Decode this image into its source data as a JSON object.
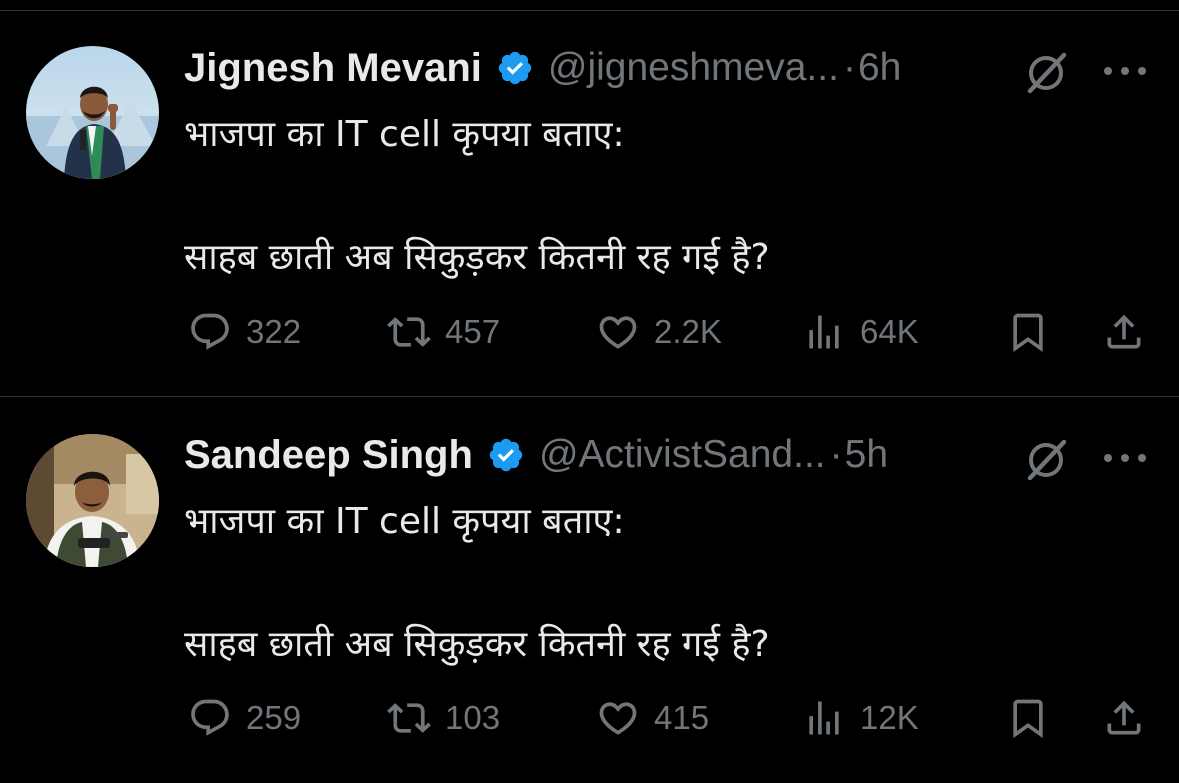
{
  "tweets": [
    {
      "name": "Jignesh Mevani",
      "handle": "@jigneshmeva...",
      "separator": "·",
      "time": "6h",
      "text_line1": "भाजपा का IT cell कृपया बताए:",
      "text_line2": "साहब छाती अब सिकुड़कर कितनी रह गई है?",
      "replies": "322",
      "retweets": "457",
      "likes": "2.2K",
      "views": "64K"
    },
    {
      "name": "Sandeep Singh",
      "handle": "@ActivistSand...",
      "separator": "·",
      "time": "5h",
      "text_line1": "भाजपा का IT cell कृपया बताए:",
      "text_line2": "साहब छाती अब सिकुड़कर कितनी रह गई है?",
      "replies": "259",
      "retweets": "103",
      "likes": "415",
      "views": "12K"
    }
  ],
  "icons": {
    "verified": "verified-badge-icon",
    "grok": "grok-icon",
    "more": "more-options-icon",
    "reply": "reply-icon",
    "retweet": "retweet-icon",
    "like": "heart-icon",
    "views": "views-icon",
    "bookmark": "bookmark-icon",
    "share": "share-icon"
  },
  "colors": {
    "background": "#000000",
    "text": "#e7e9ea",
    "secondary": "#71767b",
    "verified": "#1d9bf0",
    "divider": "#2f3336"
  }
}
